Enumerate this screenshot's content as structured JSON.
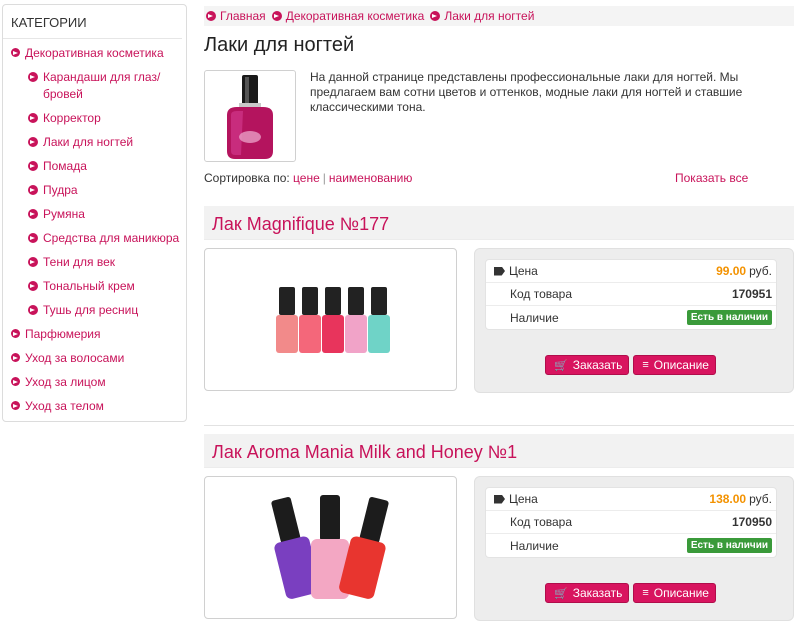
{
  "sidebar": {
    "title": "КАТЕГОРИИ",
    "items": [
      {
        "label": "Декоративная косметика",
        "level": 1
      },
      {
        "label": "Карандаши для глаз/бровей",
        "level": 2
      },
      {
        "label": "Корректор",
        "level": 2
      },
      {
        "label": "Лаки для ногтей",
        "level": 2
      },
      {
        "label": "Помада",
        "level": 2
      },
      {
        "label": "Пудра",
        "level": 2
      },
      {
        "label": "Румяна",
        "level": 2
      },
      {
        "label": "Средства для маникюра",
        "level": 2
      },
      {
        "label": "Тени для век",
        "level": 2
      },
      {
        "label": "Тональный крем",
        "level": 2
      },
      {
        "label": "Тушь для ресниц",
        "level": 2
      },
      {
        "label": "Парфюмерия",
        "level": 1
      },
      {
        "label": "Уход за волосами",
        "level": 1
      },
      {
        "label": "Уход за лицом",
        "level": 1
      },
      {
        "label": "Уход за телом",
        "level": 1
      }
    ]
  },
  "breadcrumb": [
    "Главная",
    "Декоративная косметика",
    "Лаки для ногтей"
  ],
  "page": {
    "title": "Лаки для ногтей",
    "description": "На данной странице представлены профессиональные лаки для ногтей. Мы предлагаем вам сотни цветов и оттенков, модные лаки для ногтей и ставшие классическими тона."
  },
  "sort": {
    "label": "Сортировка по:",
    "by_price": "цене",
    "separator": "|",
    "by_name": "наименованию",
    "show_all": "Показать все"
  },
  "labels": {
    "price": "Цена",
    "code": "Код товара",
    "stock": "Наличие",
    "currency": "руб.",
    "order_btn": "Заказать",
    "desc_btn": "Описание"
  },
  "products": [
    {
      "name": "Лак Magnifique №177",
      "price": "99.00",
      "code": "170951",
      "stock": "Есть в наличии"
    },
    {
      "name": "Лак Aroma Mania Milk and Honey №1",
      "price": "138.00",
      "code": "170950",
      "stock": "Есть в наличии"
    }
  ],
  "colors": {
    "accent": "#c8135a",
    "button": "#d8145f",
    "price": "#f39200",
    "stock": "#3a9a3a"
  }
}
